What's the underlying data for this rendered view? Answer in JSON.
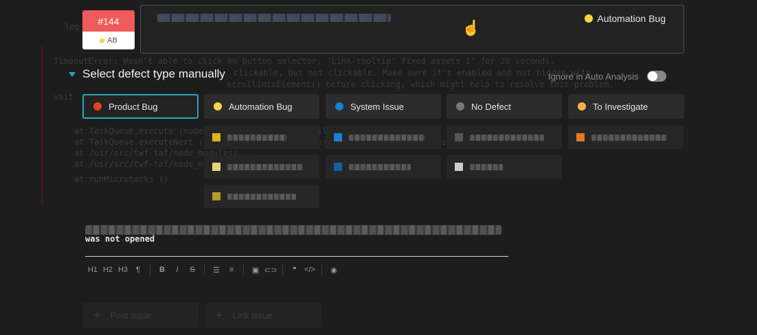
{
  "background_log": {
    "lines": [
      "TimeoutError: Wasn't able to click on button selector, 'Link-tooltip' fixed assets 1' for 20 seconds.",
      "       clickable, but not clickable. Make sure it's enabled and not hidden with",
      "         scrollIntoElement() before clicking, which might help to resolve this problem.",
      "at TaskQueue.execute (node_modules/webdriverio/build/utils/TaskQueue.js)",
      "at TaskQueue.executeNext (node_modules/webdriverio/build/utils/TaskQueue.js)",
      "at /usr/src/twf-taf/node_modules/...",
      "at /usr/src/twf-taf/node_modules/...",
      "at runMicrotasks ()",
      "wait"
    ]
  },
  "badge": {
    "number": "#144",
    "code": "AB",
    "code_color": "#f7d547",
    "color": "#f05a5a"
  },
  "top_box": {
    "defect_label": "Automation Bug",
    "defect_color": "#f7d547"
  },
  "select_header": {
    "title": "Select defect type manually"
  },
  "ignore": {
    "label": "Ignore in Auto Analysis",
    "enabled": false
  },
  "defect_types": [
    {
      "label": "Product Bug",
      "color": "#e8401c",
      "active": true
    },
    {
      "label": "Automation Bug",
      "color": "#f7d547",
      "active": false
    },
    {
      "label": "System Issue",
      "color": "#1b7fd6",
      "active": false
    },
    {
      "label": "No Defect",
      "color": "#777777",
      "active": false
    },
    {
      "label": "To Investigate",
      "color": "#f5b342",
      "active": false
    }
  ],
  "comment": {
    "visible_text": "was not opened"
  },
  "toolbar": {
    "items": [
      "H1",
      "H2",
      "H3",
      "¶",
      "B",
      "I",
      "S",
      "ul",
      "ol",
      "img",
      "link",
      "quote",
      "code",
      "preview"
    ]
  },
  "actions": {
    "post_issue": "Post issue",
    "link_issue": "Link issue"
  }
}
